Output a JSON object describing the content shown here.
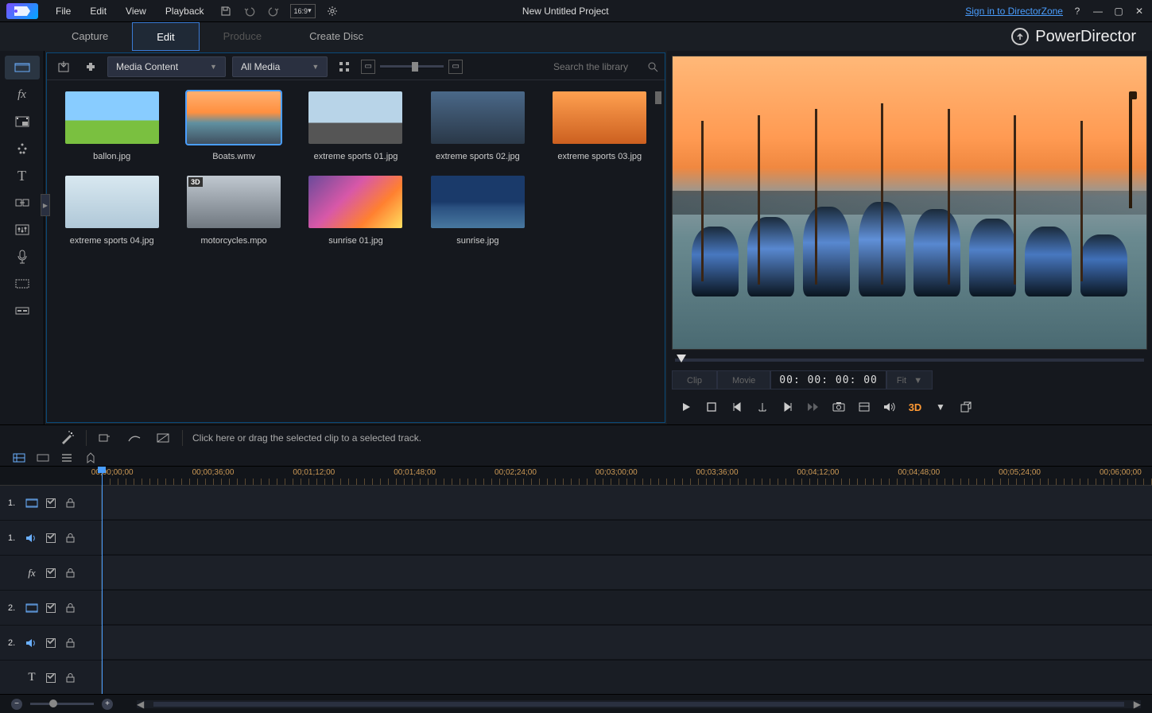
{
  "menubar": {
    "items": [
      "File",
      "Edit",
      "View",
      "Playback"
    ],
    "project_title": "New Untitled Project",
    "aspect_label": "16:9",
    "signin": "Sign in to DirectorZone"
  },
  "brand": "PowerDirector",
  "modetabs": {
    "capture": "Capture",
    "edit": "Edit",
    "produce": "Produce",
    "create_disc": "Create Disc"
  },
  "library": {
    "dropdown_content": "Media Content",
    "dropdown_filter": "All Media",
    "search_placeholder": "Search the library",
    "clips": [
      {
        "name": "ballon.jpg",
        "sel": false,
        "badge": null
      },
      {
        "name": "Boats.wmv",
        "sel": true,
        "badge": null
      },
      {
        "name": "extreme sports 01.jpg",
        "sel": false,
        "badge": null
      },
      {
        "name": "extreme sports 02.jpg",
        "sel": false,
        "badge": null
      },
      {
        "name": "extreme sports 03.jpg",
        "sel": false,
        "badge": null
      },
      {
        "name": "extreme sports 04.jpg",
        "sel": false,
        "badge": null
      },
      {
        "name": "motorcycles.mpo",
        "sel": false,
        "badge": "3D"
      },
      {
        "name": "sunrise 01.jpg",
        "sel": false,
        "badge": null
      },
      {
        "name": "sunrise.jpg",
        "sel": false,
        "badge": null
      }
    ]
  },
  "preview": {
    "mode_clip": "Clip",
    "mode_movie": "Movie",
    "timecode": "00: 00: 00: 00",
    "fit": "Fit",
    "btn_3d": "3D"
  },
  "timeline": {
    "hint": "Click here or drag the selected clip to a selected track.",
    "ruler": [
      "00;00;00;00",
      "00;00;36;00",
      "00;01;12;00",
      "00;01;48;00",
      "00;02;24;00",
      "00;03;00;00",
      "00;03;36;00",
      "00;04;12;00",
      "00;04;48;00",
      "00;05;24;00",
      "00;06;00;00"
    ],
    "tracks": [
      {
        "num": "1.",
        "type": "video"
      },
      {
        "num": "1.",
        "type": "audio"
      },
      {
        "num": "",
        "type": "fx"
      },
      {
        "num": "2.",
        "type": "video"
      },
      {
        "num": "2.",
        "type": "audio"
      },
      {
        "num": "",
        "type": "title"
      }
    ]
  },
  "thumbs": {
    "0": "linear-gradient(#88ccff 0%,#88ccff 55%,#7ac040 55%)",
    "1": "linear-gradient(180deg,#ffb070 0%,#ff9040 40%,#6090a0 60%,#405060 100%)",
    "2": "linear-gradient(#b8d4e8 0%,#b8d4e8 60%,#555 60%)",
    "3": "linear-gradient(#4a6888,#2a3848)",
    "4": "linear-gradient(#ffa050,#cc6020)",
    "5": "linear-gradient(#d8e8f0,#b0c8d8)",
    "6": "linear-gradient(#c0c8d0,#707880)",
    "7": "linear-gradient(135deg,#6a4a9a 0%,#d858a8 40%,#ff8030 70%,#ffe060 100%)",
    "8": "linear-gradient(#1a3a6a 0%,#1a3a6a 50%,#2a5080 60%,#4878a0 100%)"
  }
}
